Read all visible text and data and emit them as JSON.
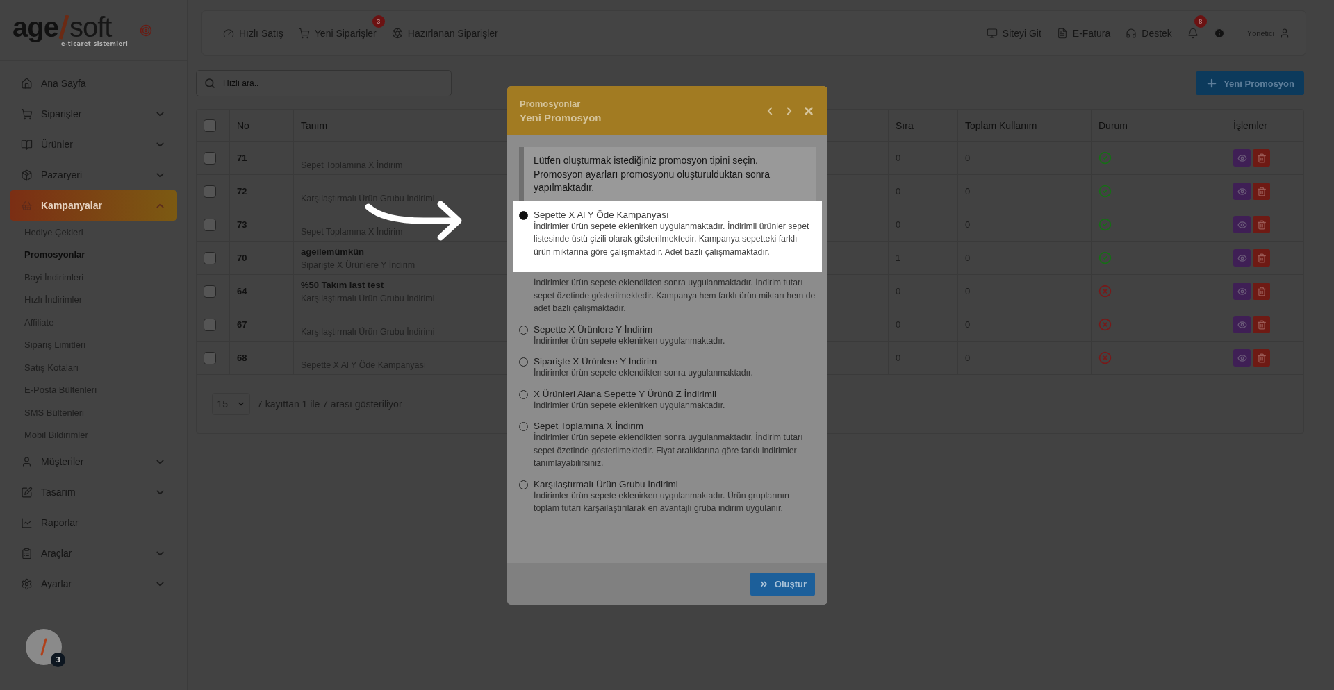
{
  "logo": {
    "left": "age",
    "right": "soft",
    "tagline": "e-ticaret sistemleri"
  },
  "sidebar": {
    "items": [
      {
        "label": "Ana Sayfa",
        "selected": false
      },
      {
        "label": "Siparişler",
        "selected": false,
        "expanded": false
      },
      {
        "label": "Ürünler",
        "selected": false,
        "expanded": false
      },
      {
        "label": "Pazaryeri",
        "selected": false,
        "expanded": false
      },
      {
        "label": "Kampanyalar",
        "selected": true,
        "expanded": true,
        "children": [
          {
            "label": "Hediye Çekleri",
            "selected": false
          },
          {
            "label": "Promosyonlar",
            "selected": true
          },
          {
            "label": "Bayi İndirimleri",
            "selected": false
          },
          {
            "label": "Hızlı İndirimler",
            "selected": false
          },
          {
            "label": "Affiliate",
            "selected": false
          },
          {
            "label": "Sipariş Limitleri",
            "selected": false
          },
          {
            "label": "Satış Kotaları",
            "selected": false
          },
          {
            "label": "E-Posta Bültenleri",
            "selected": false
          },
          {
            "label": "SMS Bültenleri",
            "selected": false
          },
          {
            "label": "Mobil Bildirimler",
            "selected": false
          }
        ]
      },
      {
        "label": "Müşteriler",
        "selected": false,
        "expanded": false
      },
      {
        "label": "Tasarım",
        "selected": false,
        "expanded": false
      },
      {
        "label": "Raporlar",
        "selected": false
      },
      {
        "label": "Araçlar",
        "selected": false,
        "expanded": false
      },
      {
        "label": "Ayarlar",
        "selected": false,
        "expanded": false
      }
    ]
  },
  "topbar": {
    "left": [
      {
        "label": "Hızlı Satış"
      },
      {
        "label": "Yeni Siparişler",
        "badge": "3"
      },
      {
        "label": "Hazırlanan Siparişler"
      }
    ],
    "right": [
      {
        "label": "Siteyi Git"
      },
      {
        "label": "E-Fatura"
      },
      {
        "label": "Destek"
      }
    ],
    "notifications_badge": "8",
    "user": "Yönetici"
  },
  "search": {
    "placeholder": "Hızlı ara.."
  },
  "new_button": "Yeni Promosyon",
  "table": {
    "select_all_checked": false,
    "columns": [
      "No",
      "Tanım",
      "Sıra",
      "Toplam Kullanım",
      "Durum",
      "İşlemler"
    ],
    "rows": [
      {
        "checked": false,
        "no": "71",
        "type": "Sepet Toplamına X İndirim",
        "order": "0",
        "usage": "0",
        "active": true
      },
      {
        "checked": false,
        "no": "72",
        "type": "Karşılaştırmalı Ürün Grubu İndirimi",
        "order": "0",
        "usage": "0",
        "active": true
      },
      {
        "checked": false,
        "no": "73",
        "type": "Sepet Toplamına X İndirim",
        "order": "0",
        "usage": "0",
        "active": true
      },
      {
        "checked": false,
        "no": "70",
        "name": "ageilemümkün",
        "type": "Siparişte X Ürünlere Y İndirim",
        "order": "1",
        "usage": "0",
        "active": true
      },
      {
        "checked": false,
        "no": "64",
        "name": "%50 Takım last test",
        "type": "Karşılaştırmalı Ürün Grubu İndirimi",
        "order": "0",
        "usage": "0",
        "active": false
      },
      {
        "checked": false,
        "no": "67",
        "type": "Karşılaştırmalı Ürün Grubu İndirimi",
        "order": "0",
        "usage": "0",
        "active": false
      },
      {
        "checked": false,
        "no": "68",
        "type": "Sepette X Al Y Öde Kampanyası",
        "order": "0",
        "usage": "0",
        "active": false
      }
    ]
  },
  "pagination": {
    "page_size": "15",
    "info": "7 kayıttan 1 ile 7 arası gösteriliyor"
  },
  "modal": {
    "breadcrumb": "Promosyonlar",
    "title": "Yeni Promosyon",
    "notice": "Lütfen oluşturmak istediğiniz promosyon tipini seçin. Promosyon ayarları promosyonu oluşturulduktan sonra yapılmaktadır.",
    "options": [
      {
        "kind": "spotlight",
        "selected": true,
        "title": "Sepette X Al Y Öde Kampanyası",
        "description": "İndirimler ürün sepete eklenirken uygulanmaktadır. İndirimli ürünler sepet listesinde üstü çizili olarak gösterilmektedir. Kampanya sepetteki farklı ürün miktarına göre çalışmaktadır. Adet bazlı çalışmamaktadır."
      },
      {
        "kind": "covered",
        "description": "İndirimler ürün sepete eklendikten sonra uygulanmaktadır. İndirim tutarı sepet özetinde gösterilmektedir. Kampanya hem farklı ürün miktarı hem de adet bazlı çalışmaktadır."
      },
      {
        "kind": "plain",
        "selected": false,
        "title": "Sepette X Ürünlere Y İndirim",
        "description": "İndirimler ürün sepete eklenirken uygulanmaktadır."
      },
      {
        "kind": "plain",
        "selected": false,
        "title": "Siparişte X Ürünlere Y İndirim",
        "description": "İndirimler ürün sepete eklendikten sonra uygulanmaktadır."
      },
      {
        "kind": "plain",
        "selected": false,
        "title": "X Ürünleri Alana Sepette Y Ürünü Z İndirimli",
        "description": "İndirimler ürün sepete eklenirken uygulanmaktadır."
      },
      {
        "kind": "plain",
        "selected": false,
        "title": "Sepet Toplamına X İndirim",
        "description": "İndirimler ürün sepete eklendikten sonra uygulanmaktadır. İndirim tutarı sepet özetinde gösterilmektedir. Fiyat aralıklarına göre farklı indirimler tanımlayabilirsiniz."
      },
      {
        "kind": "plain",
        "selected": false,
        "title": "Karşılaştırmalı Ürün Grubu İndirimi",
        "description": "İndirimler ürün sepete eklenirken uygulanmaktadır. Ürün gruplarının toplam tutarı karşailaştırılarak en avantajlı gruba indirim uygulanır."
      }
    ],
    "submit": "Oluştur"
  },
  "floating": {
    "badge": "3"
  }
}
